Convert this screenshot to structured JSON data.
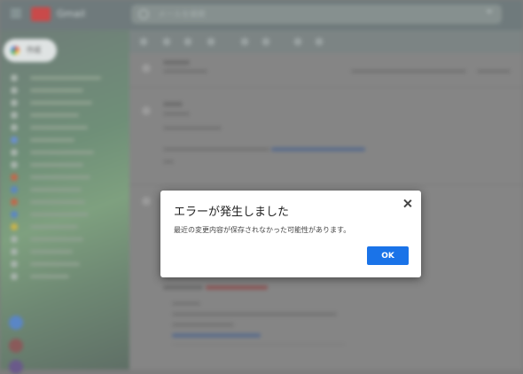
{
  "app": {
    "logo_text": "Gmail",
    "search_placeholder": "メールを検索",
    "compose_label": "作成"
  },
  "dialog": {
    "title": "エラーが発生しました",
    "message": "最近の変更内容が保存されなかった可能性があります。",
    "ok_label": "OK"
  },
  "colors": {
    "primary_button": "#1a73e8",
    "dialog_bg": "#ffffff"
  }
}
